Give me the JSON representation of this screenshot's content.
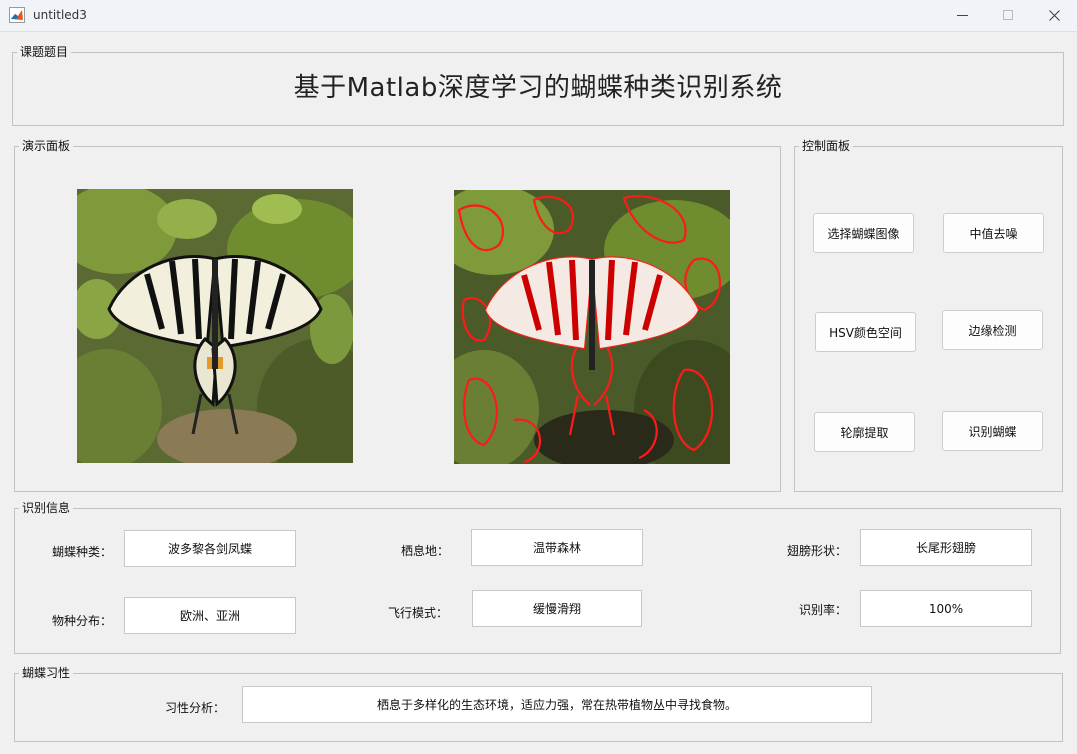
{
  "window": {
    "title": "untitled3"
  },
  "topic_panel": {
    "legend": "课题题目",
    "title": "基于Matlab深度学习的蝴蝶种类识别系统"
  },
  "demo_panel": {
    "legend": "演示面板"
  },
  "control_panel": {
    "legend": "控制面板",
    "buttons": {
      "select_image": "选择蝴蝶图像",
      "median_denoise": "中值去噪",
      "hsv": "HSV颜色空间",
      "edge": "边缘检测",
      "contour": "轮廓提取",
      "recognize": "识别蝴蝶"
    }
  },
  "info_panel": {
    "legend": "识别信息",
    "species_label": "蝴蝶种类：",
    "species_value": "波多黎各剑凤蝶",
    "habitat_label": "栖息地：",
    "habitat_value": "温带森林",
    "wing_label": "翅膀形状：",
    "wing_value": "长尾形翅膀",
    "distribution_label": "物种分布：",
    "distribution_value": "欧洲、亚洲",
    "flight_label": "飞行模式：",
    "flight_value": "缓慢滑翔",
    "rate_label": "识别率：",
    "rate_value": "100%"
  },
  "habit_panel": {
    "legend": "蝴蝶习性",
    "analysis_label": "习性分析：",
    "analysis_value": "栖息于多样化的生态环境，适应力强，常在热带植物丛中寻找食物。"
  }
}
